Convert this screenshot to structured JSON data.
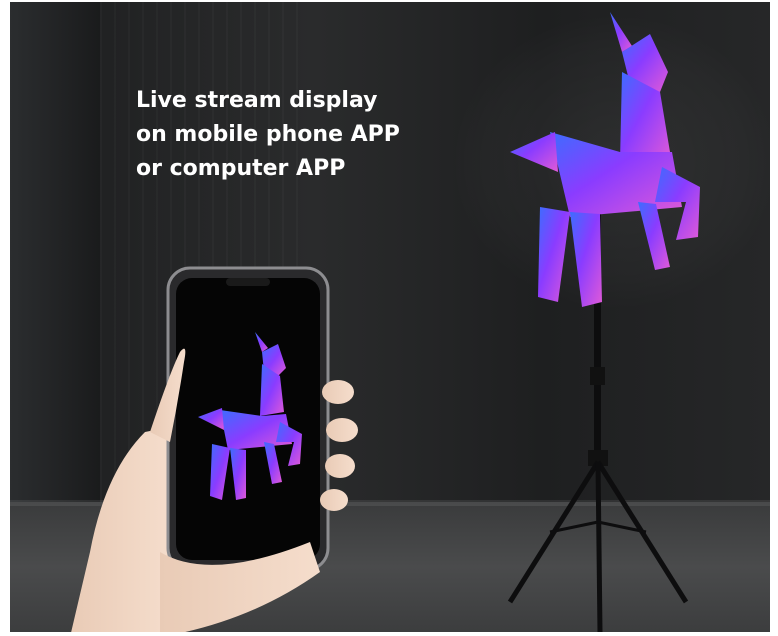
{
  "caption": {
    "lines": [
      "Live stream display",
      "on mobile phone APP",
      "or computer APP"
    ]
  },
  "colors": {
    "caption_text": "#ffffff",
    "background": "#1f2021",
    "hologram_primary": "#8a3cff",
    "hologram_secondary": "#e05ad8",
    "hologram_accent": "#3c6dff"
  },
  "icons": {
    "hologram": "unicorn-hologram-icon",
    "phone_screen": "unicorn-on-phone-icon"
  }
}
